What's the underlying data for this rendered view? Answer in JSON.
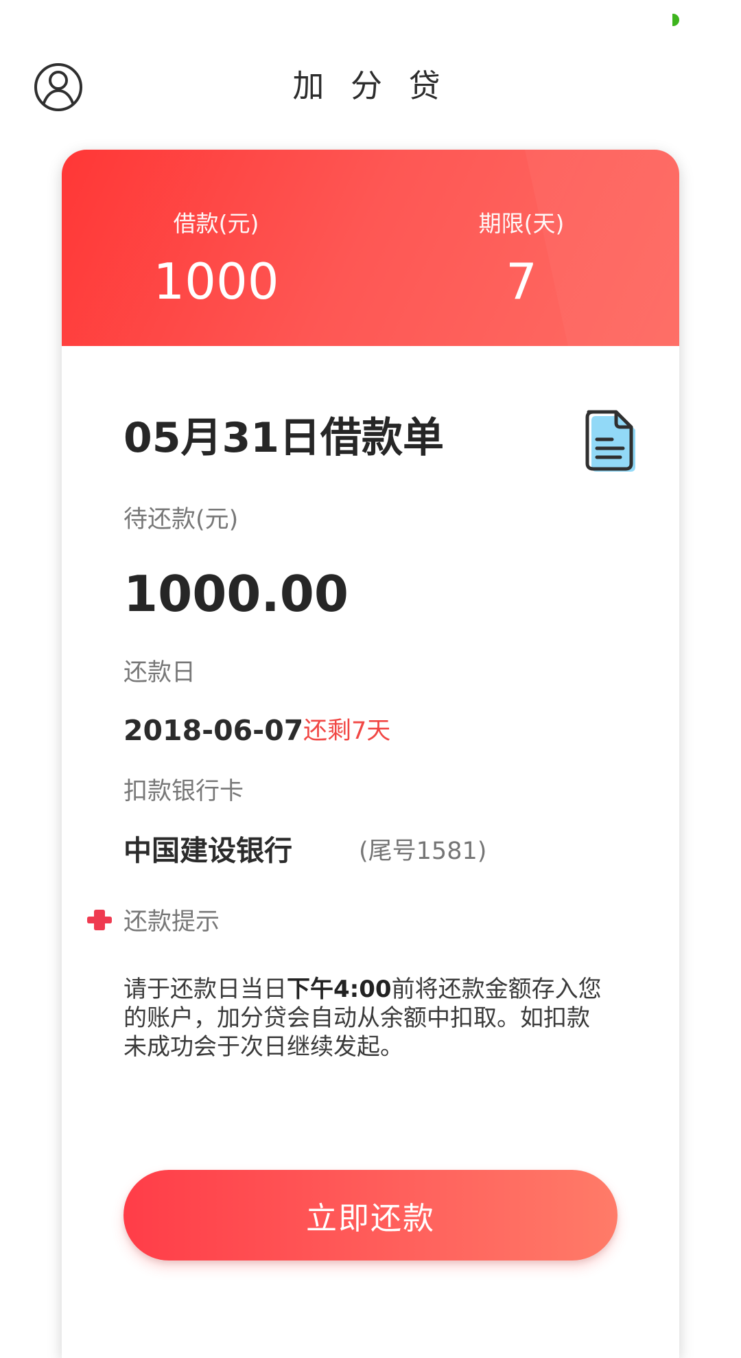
{
  "header": {
    "title": "加 分 贷",
    "profile_icon": "user-profile-icon"
  },
  "summary": {
    "loan_label": "借款(元)",
    "loan_amount": "1000",
    "term_label": "期限(天)",
    "term_days": "7"
  },
  "loan_order": {
    "title": "05月31日借款单",
    "document_icon": "document-icon",
    "pending_label": "待还款(元)",
    "pending_amount": "1000.00",
    "repayment_date_label": "还款日",
    "repayment_date": "2018-06-07",
    "days_left": "还剩7天",
    "bank_card_label": "扣款银行卡",
    "bank_name": "中国建设银行",
    "card_tail": "(尾号1581)"
  },
  "tip": {
    "icon": "plus-icon",
    "label": "还款提示",
    "text_before": "请于还款日当日",
    "deadline": "下午4:00",
    "text_after": "前将还款金额存入您的账户，加分贷会自动从余额中扣取。如扣款未成功会于次日继续发起。"
  },
  "actions": {
    "repay_now": "立即还款"
  },
  "colors": {
    "accent": "#ff4545",
    "button_start": "#ff3d48",
    "button_end": "#ff7b68",
    "status_dot": "#3db41d"
  }
}
